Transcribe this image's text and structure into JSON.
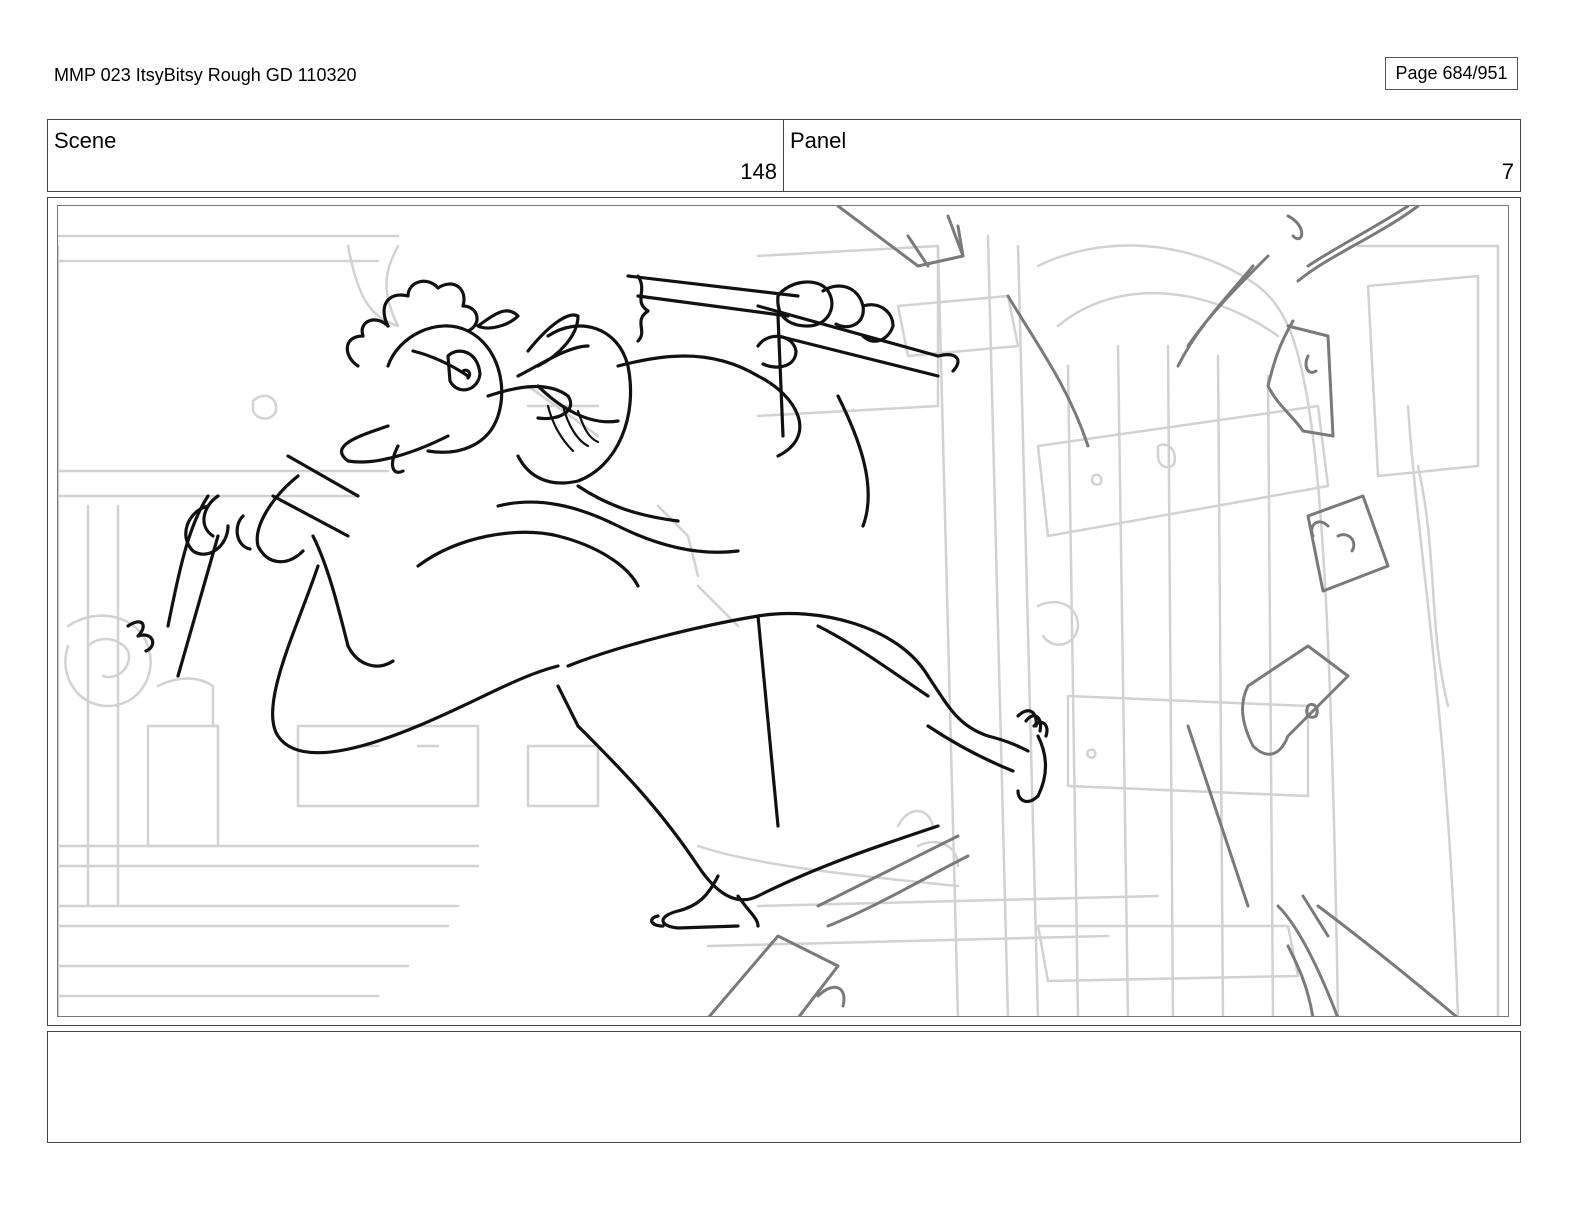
{
  "header": {
    "document_title": "MMP 023 ItsyBitsy Rough GD 110320",
    "page_label": "Page 684/951"
  },
  "info": {
    "scene_label": "Scene",
    "scene_number": "148",
    "panel_label": "Panel",
    "panel_number": "7"
  },
  "frame": {
    "image_description_icon": "storyboard-sketch"
  },
  "notes": {
    "text": ""
  }
}
